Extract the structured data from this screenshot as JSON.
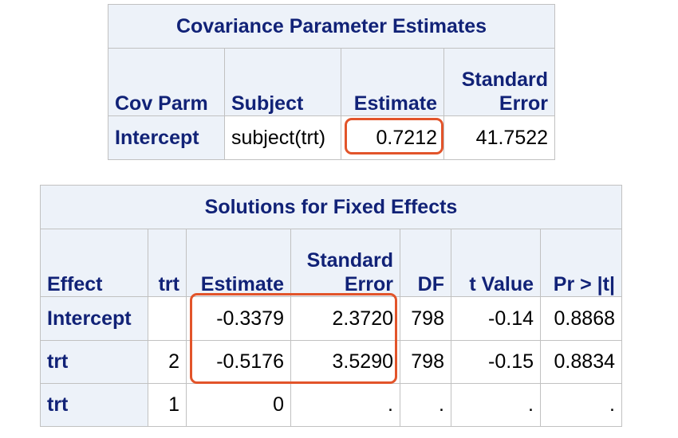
{
  "cov_table": {
    "title": "Covariance Parameter Estimates",
    "headers": [
      "Cov Parm",
      "Subject",
      "Estimate",
      "Standard Error"
    ],
    "row": {
      "cov_parm": "Intercept",
      "subject": "subject(trt)",
      "estimate": "0.7212",
      "std_error": "41.7522"
    }
  },
  "fixed_table": {
    "title": "Solutions for Fixed Effects",
    "headers": [
      "Effect",
      "trt",
      "Estimate",
      "Standard Error",
      "DF",
      "t Value",
      "Pr > |t|"
    ],
    "rows": [
      {
        "effect": "Intercept",
        "trt": "",
        "estimate": "-0.3379",
        "std_error": "2.3720",
        "df": "798",
        "t_value": "-0.14",
        "p_value": "0.8868"
      },
      {
        "effect": "trt",
        "trt": "2",
        "estimate": "-0.5176",
        "std_error": "3.5290",
        "df": "798",
        "t_value": "-0.15",
        "p_value": "0.8834"
      },
      {
        "effect": "trt",
        "trt": "1",
        "estimate": "0",
        "std_error": ".",
        "df": ".",
        "t_value": ".",
        "p_value": "."
      }
    ]
  },
  "highlight_color": "#e2542a",
  "header_bg": "#edf2f9",
  "header_text_color": "#112277"
}
